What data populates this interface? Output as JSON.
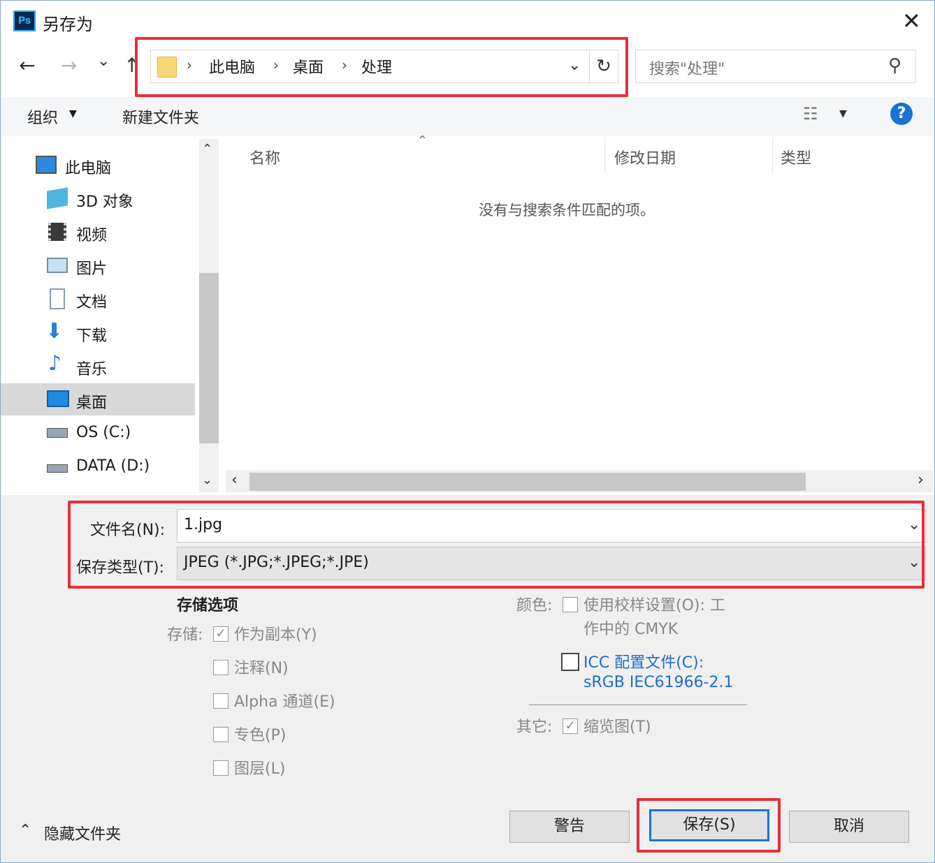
{
  "window": {
    "title": "另存为",
    "app_badge": "Ps"
  },
  "nav": {
    "back": "←",
    "forward": "→",
    "recent": "⌄",
    "up": "↑",
    "breadcrumb": [
      "此电脑",
      "桌面",
      "处理"
    ],
    "search_placeholder": "搜索\"处理\""
  },
  "toolbar": {
    "organize": "组织",
    "new_folder": "新建文件夹"
  },
  "sidebar": {
    "items": [
      {
        "label": "此电脑",
        "icon": "computer-icon"
      },
      {
        "label": "3D 对象",
        "icon": "cube-icon"
      },
      {
        "label": "视频",
        "icon": "film-icon"
      },
      {
        "label": "图片",
        "icon": "picture-icon"
      },
      {
        "label": "文档",
        "icon": "document-icon"
      },
      {
        "label": "下载",
        "icon": "download-arrow-icon"
      },
      {
        "label": "音乐",
        "icon": "music-note-icon"
      },
      {
        "label": "桌面",
        "icon": "desktop-icon",
        "selected": true
      },
      {
        "label": "OS (C:)",
        "icon": "drive-icon"
      },
      {
        "label": "DATA (D:)",
        "icon": "drive-icon"
      }
    ]
  },
  "file_list": {
    "columns": [
      "名称",
      "修改日期",
      "类型"
    ],
    "empty_message": "没有与搜索条件匹配的项。"
  },
  "form": {
    "filename_label": "文件名(N):",
    "filename_value": "1.jpg",
    "filetype_label": "保存类型(T):",
    "filetype_value": "JPEG (*.JPG;*.JPEG;*.JPE)"
  },
  "options": {
    "heading": "存储选项",
    "store_label": "存储:",
    "store_items": [
      {
        "label": "作为副本(Y)",
        "checked": true
      },
      {
        "label": "注释(N)",
        "checked": false
      },
      {
        "label": "Alpha 通道(E)",
        "checked": false
      },
      {
        "label": "专色(P)",
        "checked": false
      },
      {
        "label": "图层(L)",
        "checked": false
      }
    ],
    "color_label": "颜色:",
    "proof_line1": "使用校样设置(O): 工",
    "proof_line2": "作中的 CMYK",
    "icc_label": "ICC 配置文件(C):",
    "icc_value": "sRGB IEC61966-2.1",
    "other_label": "其它:",
    "thumbnail": "缩览图(T)"
  },
  "footer": {
    "hide_folders": "隐藏文件夹",
    "warning_button": "警告",
    "save_button": "保存(S)",
    "cancel_button": "取消"
  },
  "colors": {
    "highlight_red": "#e5303a",
    "accent_blue": "#1874d0"
  }
}
